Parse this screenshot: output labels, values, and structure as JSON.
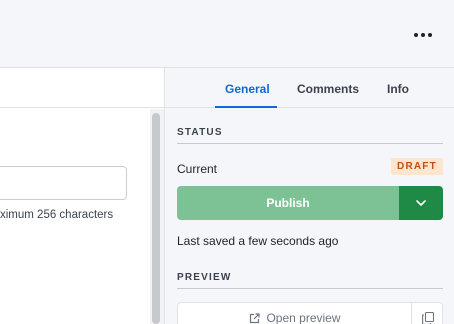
{
  "header": {
    "more_icon": "more-horizontal-icon"
  },
  "editor": {
    "helper_text": "ximum 256 characters"
  },
  "sidebar": {
    "tabs": [
      {
        "label": "General",
        "active": true
      },
      {
        "label": "Comments",
        "active": false
      },
      {
        "label": "Info",
        "active": false
      }
    ],
    "status": {
      "section_title": "STATUS",
      "current_label": "Current",
      "badge": "DRAFT",
      "publish_label": "Publish",
      "saved_text": "Last saved a few seconds ago"
    },
    "preview": {
      "section_title": "PREVIEW",
      "open_label": "Open preview"
    }
  },
  "colors": {
    "accent": "#1268d6",
    "publish_button": "#7dc295",
    "publish_menu": "#1e8a45",
    "badge_bg": "#fde6cd",
    "badge_text": "#c24e0f"
  }
}
